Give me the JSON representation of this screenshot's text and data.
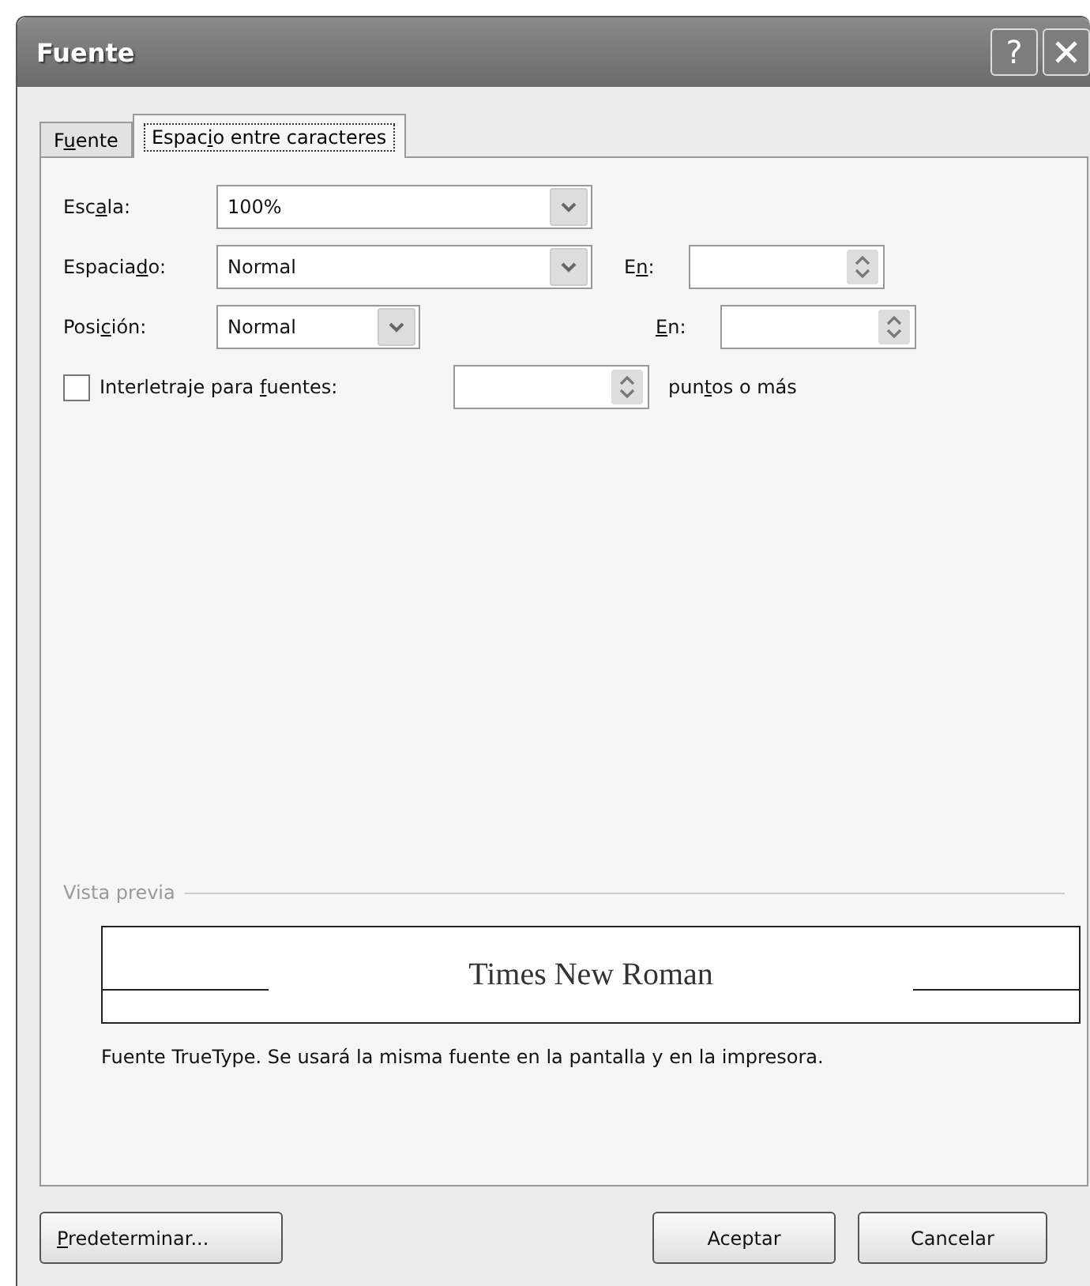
{
  "window": {
    "title": "Fuente"
  },
  "help_button": {
    "text": "?"
  },
  "tabs": [
    {
      "label": {
        "before": "F",
        "key": "u",
        "after": "ente"
      },
      "selected": false
    },
    {
      "label": {
        "before": "Espac",
        "key": "i",
        "after": "o entre caracteres"
      },
      "selected": true
    }
  ],
  "escala": {
    "label": {
      "before": "Esc",
      "key": "a",
      "after": "la:"
    },
    "value": "100%"
  },
  "espaciado": {
    "label": {
      "before": "Espacia",
      "key": "d",
      "after": "o:"
    },
    "value": "Normal",
    "en_label": {
      "before": "E",
      "key": "n",
      "after": ":"
    }
  },
  "posicion": {
    "label": {
      "before": "Posi",
      "key": "c",
      "after": "ión:"
    },
    "value": "Normal",
    "en_label": {
      "key": "E",
      "after": "n:"
    }
  },
  "kerning": {
    "label": {
      "before": "Interletraje para ",
      "key": "f",
      "after": "uentes:"
    },
    "checked": false,
    "suffix": {
      "before": "pun",
      "key": "t",
      "after": "os o más"
    }
  },
  "preview": {
    "label": "Vista previa",
    "sample": "Times New Roman",
    "note": "Fuente TrueType. Se usará la misma fuente en la pantalla y en la impresora."
  },
  "buttons": [
    {
      "label": {
        "key": "P",
        "after": "redeterminar..."
      }
    },
    {
      "label": {
        "after": "Aceptar"
      }
    },
    {
      "label": {
        "after": "Cancelar"
      }
    }
  ]
}
